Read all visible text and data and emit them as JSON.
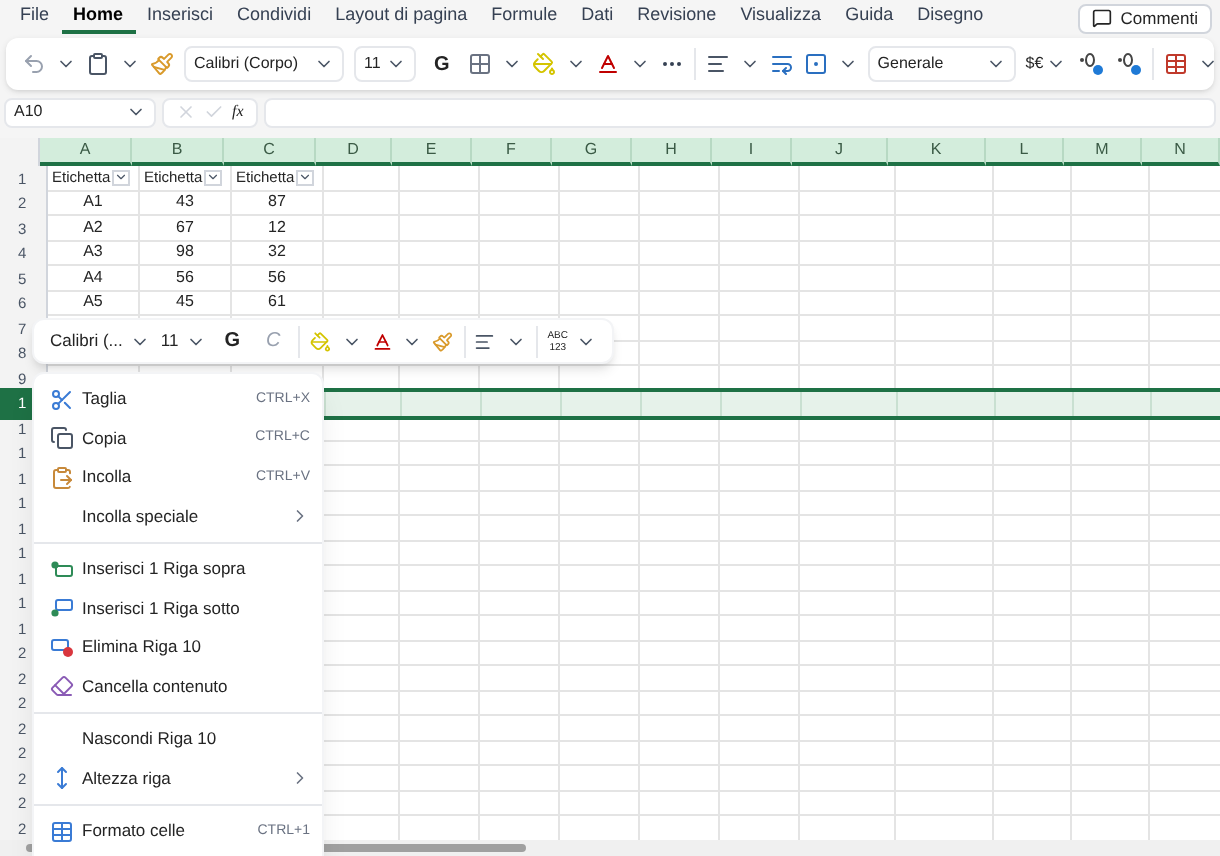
{
  "menu_tabs": [
    {
      "label": "File",
      "selected": false
    },
    {
      "label": "Home",
      "selected": true
    },
    {
      "label": "Inserisci",
      "selected": false
    },
    {
      "label": "Condividi",
      "selected": false
    },
    {
      "label": "Layout di pagina",
      "selected": false
    },
    {
      "label": "Formule",
      "selected": false
    },
    {
      "label": "Dati",
      "selected": false
    },
    {
      "label": "Revisione",
      "selected": false
    },
    {
      "label": "Visualizza",
      "selected": false
    },
    {
      "label": "Guida",
      "selected": false
    },
    {
      "label": "Disegno",
      "selected": false
    }
  ],
  "comments_button": {
    "label": "Commenti"
  },
  "ribbon": {
    "font_name": "Calibri (Corpo)",
    "font_size": "11",
    "bold_label": "G",
    "number_format": "Generale",
    "currency_label": "$€"
  },
  "formula_bar": {
    "name_box": "A10",
    "fx_label": "fx"
  },
  "sheet": {
    "columns": [
      "A",
      "B",
      "C",
      "D",
      "E",
      "F",
      "G",
      "H",
      "I",
      "J",
      "K",
      "L",
      "M",
      "N"
    ],
    "header_row": {
      "label": "1",
      "selected": false,
      "cells": [
        "Etichetta",
        "Etichetta",
        "Etichetta"
      ]
    },
    "rows": [
      {
        "label": "2",
        "selected": false,
        "cells": [
          "A1",
          "43",
          "87"
        ]
      },
      {
        "label": "3",
        "selected": false,
        "cells": [
          "A2",
          "67",
          "12"
        ]
      },
      {
        "label": "4",
        "selected": false,
        "cells": [
          "A3",
          "98",
          "32"
        ]
      },
      {
        "label": "5",
        "selected": false,
        "cells": [
          "A4",
          "56",
          "56"
        ]
      },
      {
        "label": "6",
        "selected": false,
        "cells": [
          "A5",
          "45",
          "61"
        ]
      },
      {
        "label": "7",
        "selected": false,
        "cells": []
      },
      {
        "label": "8",
        "selected": false,
        "cells": []
      },
      {
        "label": "9",
        "selected": false,
        "cells": []
      },
      {
        "label": "1",
        "selected": true,
        "cells": []
      },
      {
        "label": "1",
        "selected": false,
        "cells": []
      },
      {
        "label": "1",
        "selected": false,
        "cells": []
      },
      {
        "label": "1",
        "selected": false,
        "cells": []
      },
      {
        "label": "1",
        "selected": false,
        "cells": []
      },
      {
        "label": "1",
        "selected": false,
        "cells": []
      },
      {
        "label": "1",
        "selected": false,
        "cells": []
      },
      {
        "label": "1",
        "selected": false,
        "cells": []
      },
      {
        "label": "1",
        "selected": false,
        "cells": []
      },
      {
        "label": "1",
        "selected": false,
        "cells": []
      },
      {
        "label": "2",
        "selected": false,
        "cells": []
      },
      {
        "label": "2",
        "selected": false,
        "cells": []
      },
      {
        "label": "2",
        "selected": false,
        "cells": []
      },
      {
        "label": "2",
        "selected": false,
        "cells": []
      },
      {
        "label": "2",
        "selected": false,
        "cells": []
      },
      {
        "label": "2",
        "selected": false,
        "cells": []
      },
      {
        "label": "2",
        "selected": false,
        "cells": []
      },
      {
        "label": "2",
        "selected": false,
        "cells": []
      }
    ]
  },
  "mini_toolbar": {
    "font_name": "Calibri (...",
    "font_size": "11",
    "bold_label": "G",
    "italic_label": "C",
    "number_format_label": [
      "ABC",
      "123"
    ]
  },
  "context_menu": [
    {
      "label": "Taglia",
      "shortcut": "CTRL+X",
      "has_submenu": false,
      "divider_before": false
    },
    {
      "label": "Copia",
      "shortcut": "CTRL+C",
      "has_submenu": false,
      "divider_before": false
    },
    {
      "label": "Incolla",
      "shortcut": "CTRL+V",
      "has_submenu": false,
      "divider_before": false
    },
    {
      "label": "Incolla speciale",
      "has_submenu": true,
      "divider_before": false
    },
    {
      "label": "Inserisci 1 Riga sopra",
      "has_submenu": false,
      "divider_before": true
    },
    {
      "label": "Inserisci 1 Riga sotto",
      "has_submenu": false,
      "divider_before": false
    },
    {
      "label": "Elimina Riga 10",
      "has_submenu": false,
      "divider_before": false
    },
    {
      "label": "Cancella contenuto",
      "has_submenu": false,
      "divider_before": false
    },
    {
      "label": "Nascondi Riga 10",
      "has_submenu": false,
      "divider_before": true
    },
    {
      "label": "Altezza riga",
      "has_submenu": true,
      "divider_before": false
    },
    {
      "label": "Formato celle",
      "shortcut": "CTRL+1",
      "has_submenu": false,
      "divider_before": true
    }
  ]
}
